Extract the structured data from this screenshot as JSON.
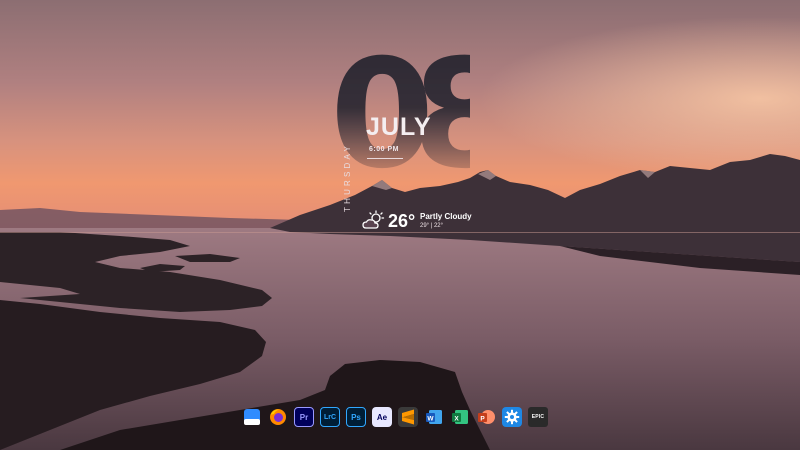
{
  "clock_widget": {
    "day_number": "08",
    "weekday": "THURSDAY",
    "month": "JULY",
    "time": "6:00 PM"
  },
  "weather_widget": {
    "icon": "partly-cloudy-icon",
    "temperature": "26°",
    "condition": "Partly Cloudy",
    "range": "29° | 22°"
  },
  "dock": {
    "apps": [
      {
        "name": "files",
        "icon": "folder-icon",
        "label": ""
      },
      {
        "name": "firefox",
        "icon": "firefox-icon",
        "label": ""
      },
      {
        "name": "premiere-pro",
        "icon": "premiere-pro-icon",
        "label": "Pr",
        "color": "#00005b",
        "text_color": "#9999ff"
      },
      {
        "name": "lightroom-classic",
        "icon": "lightroom-classic-icon",
        "label": "LrC",
        "color": "#001e36",
        "text_color": "#31a8ff"
      },
      {
        "name": "photoshop",
        "icon": "photoshop-icon",
        "label": "Ps",
        "color": "#001e36",
        "text_color": "#31a8ff"
      },
      {
        "name": "after-effects",
        "icon": "after-effects-icon",
        "label": "Ae",
        "color": "#00005b",
        "text_color": "#9999ff"
      },
      {
        "name": "sublime-text",
        "icon": "sublime-text-icon",
        "label": "S"
      },
      {
        "name": "word",
        "icon": "word-icon",
        "label": "W"
      },
      {
        "name": "excel",
        "icon": "excel-icon",
        "label": "X"
      },
      {
        "name": "powerpoint",
        "icon": "powerpoint-icon",
        "label": "P"
      },
      {
        "name": "settings",
        "icon": "gear-icon",
        "label": ""
      },
      {
        "name": "epic-games",
        "icon": "epic-games-icon",
        "label": "EPIC"
      }
    ]
  }
}
